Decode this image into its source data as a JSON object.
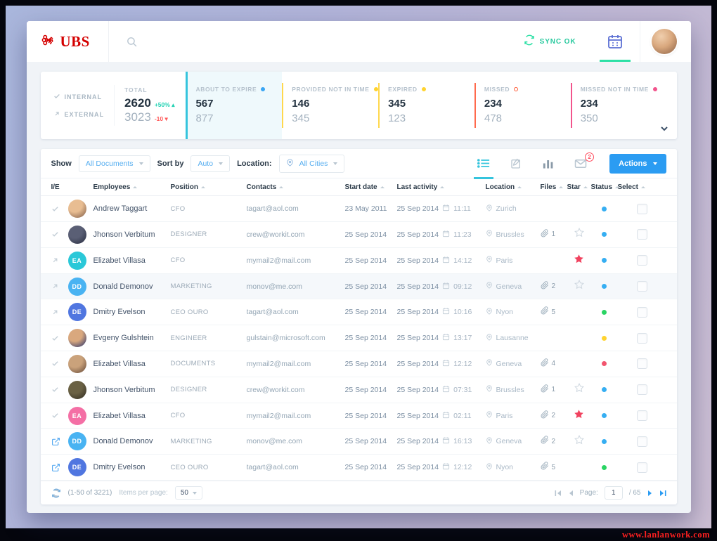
{
  "header": {
    "logo_text": "UBS",
    "sync_label": "SYNC OK"
  },
  "stats": {
    "internal_label": "INTERNAL",
    "external_label": "EXTERNAL",
    "total": {
      "label": "TOTAL",
      "internal_value": "2620",
      "internal_delta": "+50%",
      "external_value": "3023",
      "external_delta": "-10"
    },
    "cards": [
      {
        "label": "ABOUT TO EXPIRE",
        "internal": "567",
        "external": "877",
        "accent": "#35c4dd",
        "dot": "#3aa6f4",
        "hollow": false,
        "active": true
      },
      {
        "label": "PROVIDED NOT IN TIME",
        "internal": "146",
        "external": "345",
        "accent": "#ffd84d",
        "dot": "#ffd330",
        "hollow": false,
        "active": false
      },
      {
        "label": "EXPIRED",
        "internal": "345",
        "external": "123",
        "accent": "#ffd84d",
        "dot": "#ffd330",
        "hollow": false,
        "active": false
      },
      {
        "label": "MISSED",
        "internal": "234",
        "external": "478",
        "accent": "#ff6a4d",
        "dot": "#ff5a36",
        "hollow": true,
        "active": false
      },
      {
        "label": "MISSED NOT IN TIME",
        "internal": "234",
        "external": "350",
        "accent": "#f2548c",
        "dot": "#f2548c",
        "hollow": false,
        "active": false
      }
    ]
  },
  "toolbar": {
    "show_label": "Show",
    "show_value": "All Documents",
    "sort_label": "Sort by",
    "sort_value": "Auto",
    "location_label": "Location:",
    "location_value": "All Cities",
    "mail_badge": "2",
    "actions_label": "Actions"
  },
  "table": {
    "columns": [
      "I/E",
      "Employees",
      "Position",
      "Contacts",
      "Start date",
      "Last activity",
      "Location",
      "Files",
      "Star",
      "Status",
      "Select"
    ],
    "rows": [
      {
        "ie": "check",
        "avatar": {
          "kind": "photo",
          "c1": "#e8bd92",
          "c2": "#7a5743"
        },
        "name": "Andrew Taggart",
        "position": "CFO",
        "contact": "tagart@aol.com",
        "start_date": "23 May 2011",
        "activity_date": "25 Sep 2014",
        "activity_time": "11:11",
        "location": "Zurich",
        "files": "",
        "star": "none",
        "status": "#36aef2",
        "highlighted": false
      },
      {
        "ie": "check",
        "avatar": {
          "kind": "photo",
          "c1": "#5a5f75",
          "c2": "#262b3e"
        },
        "name": "Jhonson Verbitum",
        "position": "DESIGNER",
        "contact": "crew@workit.com",
        "start_date": "25 Sep 2014",
        "activity_date": "25 Sep 2014",
        "activity_time": "11:23",
        "location": "Brussles",
        "files": "1",
        "star": "empty",
        "status": "#36aef2",
        "highlighted": false
      },
      {
        "ie": "arrow",
        "avatar": {
          "kind": "initials",
          "text": "EA",
          "color": "#2bc8d8"
        },
        "name": "Elizabet Villasa",
        "position": "CFO",
        "contact": "mymail2@mail.com",
        "start_date": "25 Sep 2014",
        "activity_date": "25 Sep 2014",
        "activity_time": "14:12",
        "location": "Paris",
        "files": "",
        "star": "filled",
        "status": "#36aef2",
        "highlighted": false
      },
      {
        "ie": "arrow",
        "avatar": {
          "kind": "initials",
          "text": "DD",
          "color": "#49b3f2"
        },
        "name": "Donald Demonov",
        "position": "MARKETING",
        "contact": "monov@me.com",
        "start_date": "25 Sep 2014",
        "activity_date": "25 Sep 2014",
        "activity_time": "09:12",
        "location": "Geneva",
        "files": "2",
        "star": "empty",
        "status": "#36aef2",
        "highlighted": true
      },
      {
        "ie": "arrow",
        "avatar": {
          "kind": "initials",
          "text": "DE",
          "color": "#5076e0"
        },
        "name": "Dmitry Evelson",
        "position": "CEO OURO",
        "contact": "tagart@aol.com",
        "start_date": "25 Sep 2014",
        "activity_date": "25 Sep 2014",
        "activity_time": "10:16",
        "location": "Nyon",
        "files": "5",
        "star": "none",
        "status": "#2ad463",
        "highlighted": false
      },
      {
        "ie": "check",
        "avatar": {
          "kind": "photo",
          "c1": "#d9a87e",
          "c2": "#1b2a6b"
        },
        "name": "Evgeny Gulshtein",
        "position": "ENGINEER",
        "contact": "gulstain@microsoft.com",
        "start_date": "25 Sep 2014",
        "activity_date": "25 Sep 2014",
        "activity_time": "13:17",
        "location": "Lausanne",
        "files": "",
        "star": "none",
        "status": "#ffd330",
        "highlighted": false
      },
      {
        "ie": "check",
        "avatar": {
          "kind": "photo",
          "c1": "#caa27b",
          "c2": "#5f4433"
        },
        "name": "Elizabet Villasa",
        "position": "DOCUMENTS",
        "contact": "mymail2@mail.com",
        "start_date": "25 Sep 2014",
        "activity_date": "25 Sep 2014",
        "activity_time": "12:12",
        "location": "Geneva",
        "files": "4",
        "star": "none",
        "status": "#f2556e",
        "highlighted": false
      },
      {
        "ie": "check",
        "avatar": {
          "kind": "photo",
          "c1": "#6a6144",
          "c2": "#2e2a20"
        },
        "name": "Jhonson Verbitum",
        "position": "DESIGNER",
        "contact": "crew@workit.com",
        "start_date": "25 Sep 2014",
        "activity_date": "25 Sep 2014",
        "activity_time": "07:31",
        "location": "Brussles",
        "files": "1",
        "star": "empty",
        "status": "#36aef2",
        "highlighted": false
      },
      {
        "ie": "check",
        "avatar": {
          "kind": "initials",
          "text": "EA",
          "color": "#f46fa5"
        },
        "name": "Elizabet Villasa",
        "position": "CFO",
        "contact": "mymail2@mail.com",
        "start_date": "25 Sep 2014",
        "activity_date": "25 Sep 2014",
        "activity_time": "02:11",
        "location": "Paris",
        "files": "2",
        "star": "filled",
        "status": "#36aef2",
        "highlighted": false
      },
      {
        "ie": "external",
        "avatar": {
          "kind": "initials",
          "text": "DD",
          "color": "#49b3f2"
        },
        "name": "Donald Demonov",
        "position": "MARKETING",
        "contact": "monov@me.com",
        "start_date": "25 Sep 2014",
        "activity_date": "25 Sep 2014",
        "activity_time": "16:13",
        "location": "Geneva",
        "files": "2",
        "star": "empty",
        "status": "#36aef2",
        "highlighted": false
      },
      {
        "ie": "external",
        "avatar": {
          "kind": "initials",
          "text": "DE",
          "color": "#5076e0"
        },
        "name": "Dmitry Evelson",
        "position": "CEO OURO",
        "contact": "tagart@aol.com",
        "start_date": "25 Sep 2014",
        "activity_date": "25 Sep 2014",
        "activity_time": "12:12",
        "location": "Nyon",
        "files": "5",
        "star": "none",
        "status": "#2ad463",
        "highlighted": false
      }
    ]
  },
  "footer": {
    "range_text": "(1-50 of 3221)",
    "items_per_page_label": "Items per page:",
    "items_per_page_value": "50",
    "page_label": "Page:",
    "page_value": "1",
    "page_total": "/ 65"
  },
  "watermark": "www.lanlanwork.com"
}
